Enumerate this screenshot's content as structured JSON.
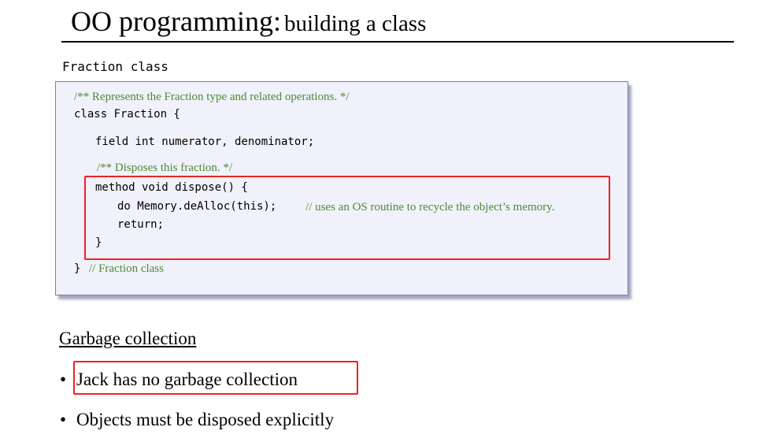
{
  "slide": {
    "title_main": "OO programming:",
    "title_sub": "building a class",
    "section_label": "Fraction class"
  },
  "code": {
    "doc_comment": "/** Represents the Fraction type and related operations. */",
    "class_decl": "class Fraction {",
    "field_decl": "field int numerator, denominator;",
    "method_comment": "/** Disposes this fraction. */",
    "method_decl": "method void dispose() {",
    "dealloc_stmt": "do Memory.deAlloc(this);",
    "dealloc_comment": "// uses an OS routine to recycle the object’s memory.",
    "return_stmt": "return;",
    "method_close": "}",
    "class_close": "}",
    "class_close_comment": "// Fraction class"
  },
  "garbage": {
    "heading": "Garbage collection",
    "bullets": [
      "Jack has no garbage collection",
      "Objects must be disposed explicitly"
    ],
    "bullet_glyph": "•"
  },
  "colors": {
    "comment_green": "#4f8a35",
    "highlight_red": "#ee2222",
    "code_bg": "#f0f1fa"
  }
}
